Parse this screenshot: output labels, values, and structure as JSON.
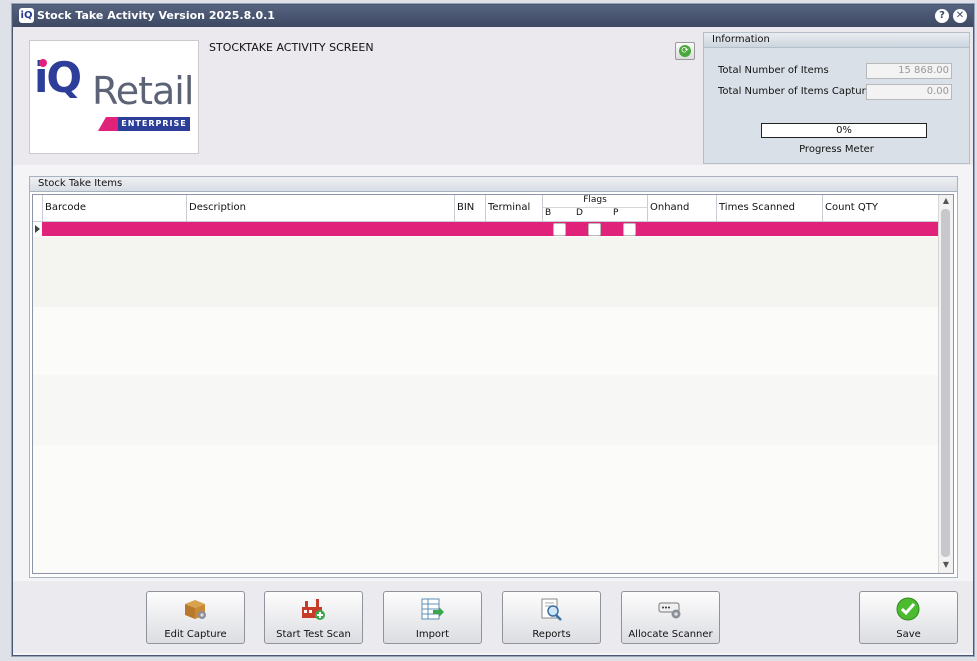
{
  "window": {
    "title": "Stock Take Activity Version 2025.8.0.1",
    "help_glyph": "?",
    "close_glyph": "✕",
    "app_icon_glyph": "iQ"
  },
  "logo": {
    "brand_iq": "iQ",
    "brand_retail": "Retail",
    "brand_sub": "ENTERPRISE"
  },
  "header": {
    "screen_title": "STOCKTAKE ACTIVITY SCREEN",
    "refresh_glyph": "⟳"
  },
  "info": {
    "title": "Information",
    "total_items_label": "Total Number of Items",
    "total_items_value": "15 868.00",
    "captured_label": "Total Number of Items Captured",
    "captured_value": "0.00",
    "progress_text": "0%",
    "progress_value": 0,
    "progress_label": "Progress Meter"
  },
  "items_panel": {
    "title": "Stock Take Items",
    "columns": {
      "barcode": "Barcode",
      "description": "Description",
      "bin": "BIN",
      "terminal": "Terminal",
      "flags": "Flags",
      "flag_b": "B",
      "flag_d": "D",
      "flag_p": "P",
      "onhand": "Onhand",
      "times_scanned": "Times Scanned",
      "count_qty": "Count QTY"
    },
    "scroll_up": "▲",
    "scroll_down": "▼"
  },
  "buttons": {
    "edit_capture": "Edit Capture",
    "start_test_scan": "Start Test Scan",
    "import": "Import",
    "reports": "Reports",
    "allocate_scanner": "Allocate Scanner",
    "save": "Save"
  },
  "colors": {
    "selected_row": "#e0227a",
    "title_bar": "#3d4963",
    "brand_blue": "#2c3e99"
  }
}
